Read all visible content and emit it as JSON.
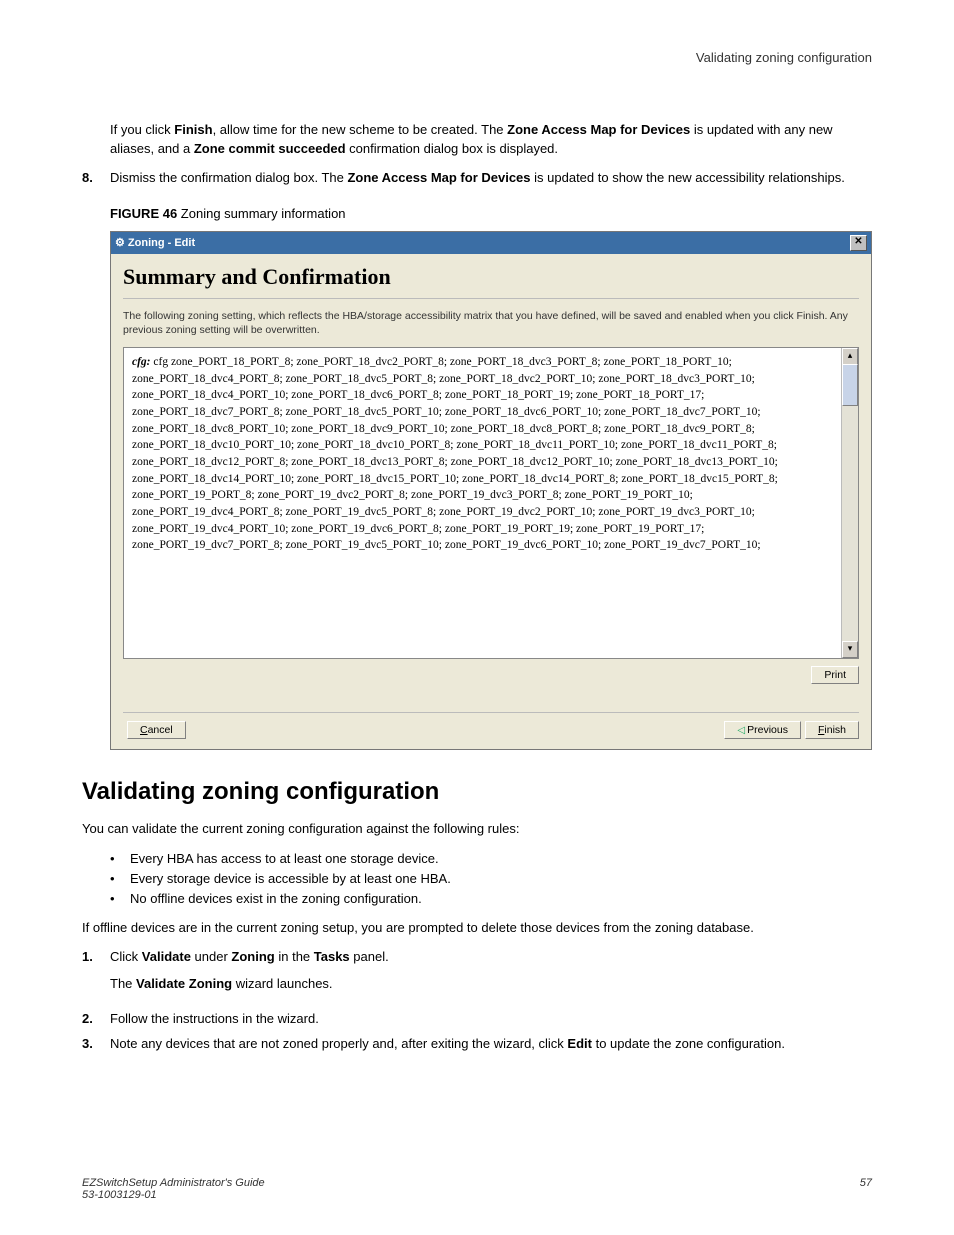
{
  "running_head": "Validating zoning configuration",
  "para_finish_pre": "If you click ",
  "bold_finish": "Finish",
  "para_finish_mid1": ", allow time for the new scheme to be created. The ",
  "bold_zone_map1": "Zone Access Map for Devices",
  "para_finish_mid2": " is updated with any new aliases, and a ",
  "bold_commit": "Zone commit succeeded",
  "para_finish_tail": " confirmation dialog box is displayed.",
  "step8_num": "8.",
  "step8_pre": "Dismiss the confirmation dialog box. The ",
  "bold_zone_map2": "Zone Access Map for Devices",
  "step8_tail": " is updated to show the new accessibility relationships.",
  "fig_label": "FIGURE 46",
  "fig_title": " Zoning summary information",
  "dlg_title": "Zoning - Edit",
  "dlg_heading": "Summary and Confirmation",
  "dlg_note": "The following zoning setting, which reflects the HBA/storage accessibility matrix that you have defined, will be saved and enabled when you click Finish. Any previous zoning setting will be overwritten.",
  "cfg_label": "cfg:",
  "cfg_body": " cfg zone_PORT_18_PORT_8; zone_PORT_18_dvc2_PORT_8; zone_PORT_18_dvc3_PORT_8; zone_PORT_18_PORT_10; zone_PORT_18_dvc4_PORT_8; zone_PORT_18_dvc5_PORT_8; zone_PORT_18_dvc2_PORT_10; zone_PORT_18_dvc3_PORT_10; zone_PORT_18_dvc4_PORT_10; zone_PORT_18_dvc6_PORT_8; zone_PORT_18_PORT_19; zone_PORT_18_PORT_17; zone_PORT_18_dvc7_PORT_8; zone_PORT_18_dvc5_PORT_10; zone_PORT_18_dvc6_PORT_10; zone_PORT_18_dvc7_PORT_10; zone_PORT_18_dvc8_PORT_10; zone_PORT_18_dvc9_PORT_10; zone_PORT_18_dvc8_PORT_8; zone_PORT_18_dvc9_PORT_8; zone_PORT_18_dvc10_PORT_10; zone_PORT_18_dvc10_PORT_8; zone_PORT_18_dvc11_PORT_10; zone_PORT_18_dvc11_PORT_8; zone_PORT_18_dvc12_PORT_8; zone_PORT_18_dvc13_PORT_8; zone_PORT_18_dvc12_PORT_10; zone_PORT_18_dvc13_PORT_10; zone_PORT_18_dvc14_PORT_10; zone_PORT_18_dvc15_PORT_10; zone_PORT_18_dvc14_PORT_8; zone_PORT_18_dvc15_PORT_8; zone_PORT_19_PORT_8; zone_PORT_19_dvc2_PORT_8; zone_PORT_19_dvc3_PORT_8; zone_PORT_19_PORT_10; zone_PORT_19_dvc4_PORT_8; zone_PORT_19_dvc5_PORT_8; zone_PORT_19_dvc2_PORT_10; zone_PORT_19_dvc3_PORT_10; zone_PORT_19_dvc4_PORT_10; zone_PORT_19_dvc6_PORT_8; zone_PORT_19_PORT_19; zone_PORT_19_PORT_17; zone_PORT_19_dvc7_PORT_8; zone_PORT_19_dvc5_PORT_10; zone_PORT_19_dvc6_PORT_10; zone_PORT_19_dvc7_PORT_10;",
  "btn_print": "Print",
  "btn_cancel": "Cancel",
  "btn_prev": "Previous",
  "btn_finish": "Finish",
  "section_heading": "Validating zoning configuration",
  "val_intro": "You can validate the current zoning configuration against the following rules:",
  "val_b1": "Every HBA has access to at least one storage device.",
  "val_b2": "Every storage device is accessible by at least one HBA.",
  "val_b3": "No offline devices exist in the zoning configuration.",
  "val_offline": "If offline devices are in the current zoning setup, you are prompted to delete those devices from the zoning database.",
  "s1_num": "1.",
  "s1_pre": "Click ",
  "s1_b1": "Validate",
  "s1_mid1": " under ",
  "s1_b2": "Zoning",
  "s1_mid2": " in the ",
  "s1_b3": "Tasks",
  "s1_tail": " panel.",
  "s1_sub_pre": "The ",
  "s1_sub_b": "Validate Zoning",
  "s1_sub_tail": " wizard launches.",
  "s2_num": "2.",
  "s2_text": "Follow the instructions in the wizard.",
  "s3_num": "3.",
  "s3_pre": "Note any devices that are not zoned properly and, after exiting the wizard, click ",
  "s3_b": "Edit",
  "s3_tail": " to update the zone configuration.",
  "footer_title": "EZSwitchSetup Administrator's Guide",
  "footer_doc": "53-1003129-01",
  "footer_page": "57"
}
